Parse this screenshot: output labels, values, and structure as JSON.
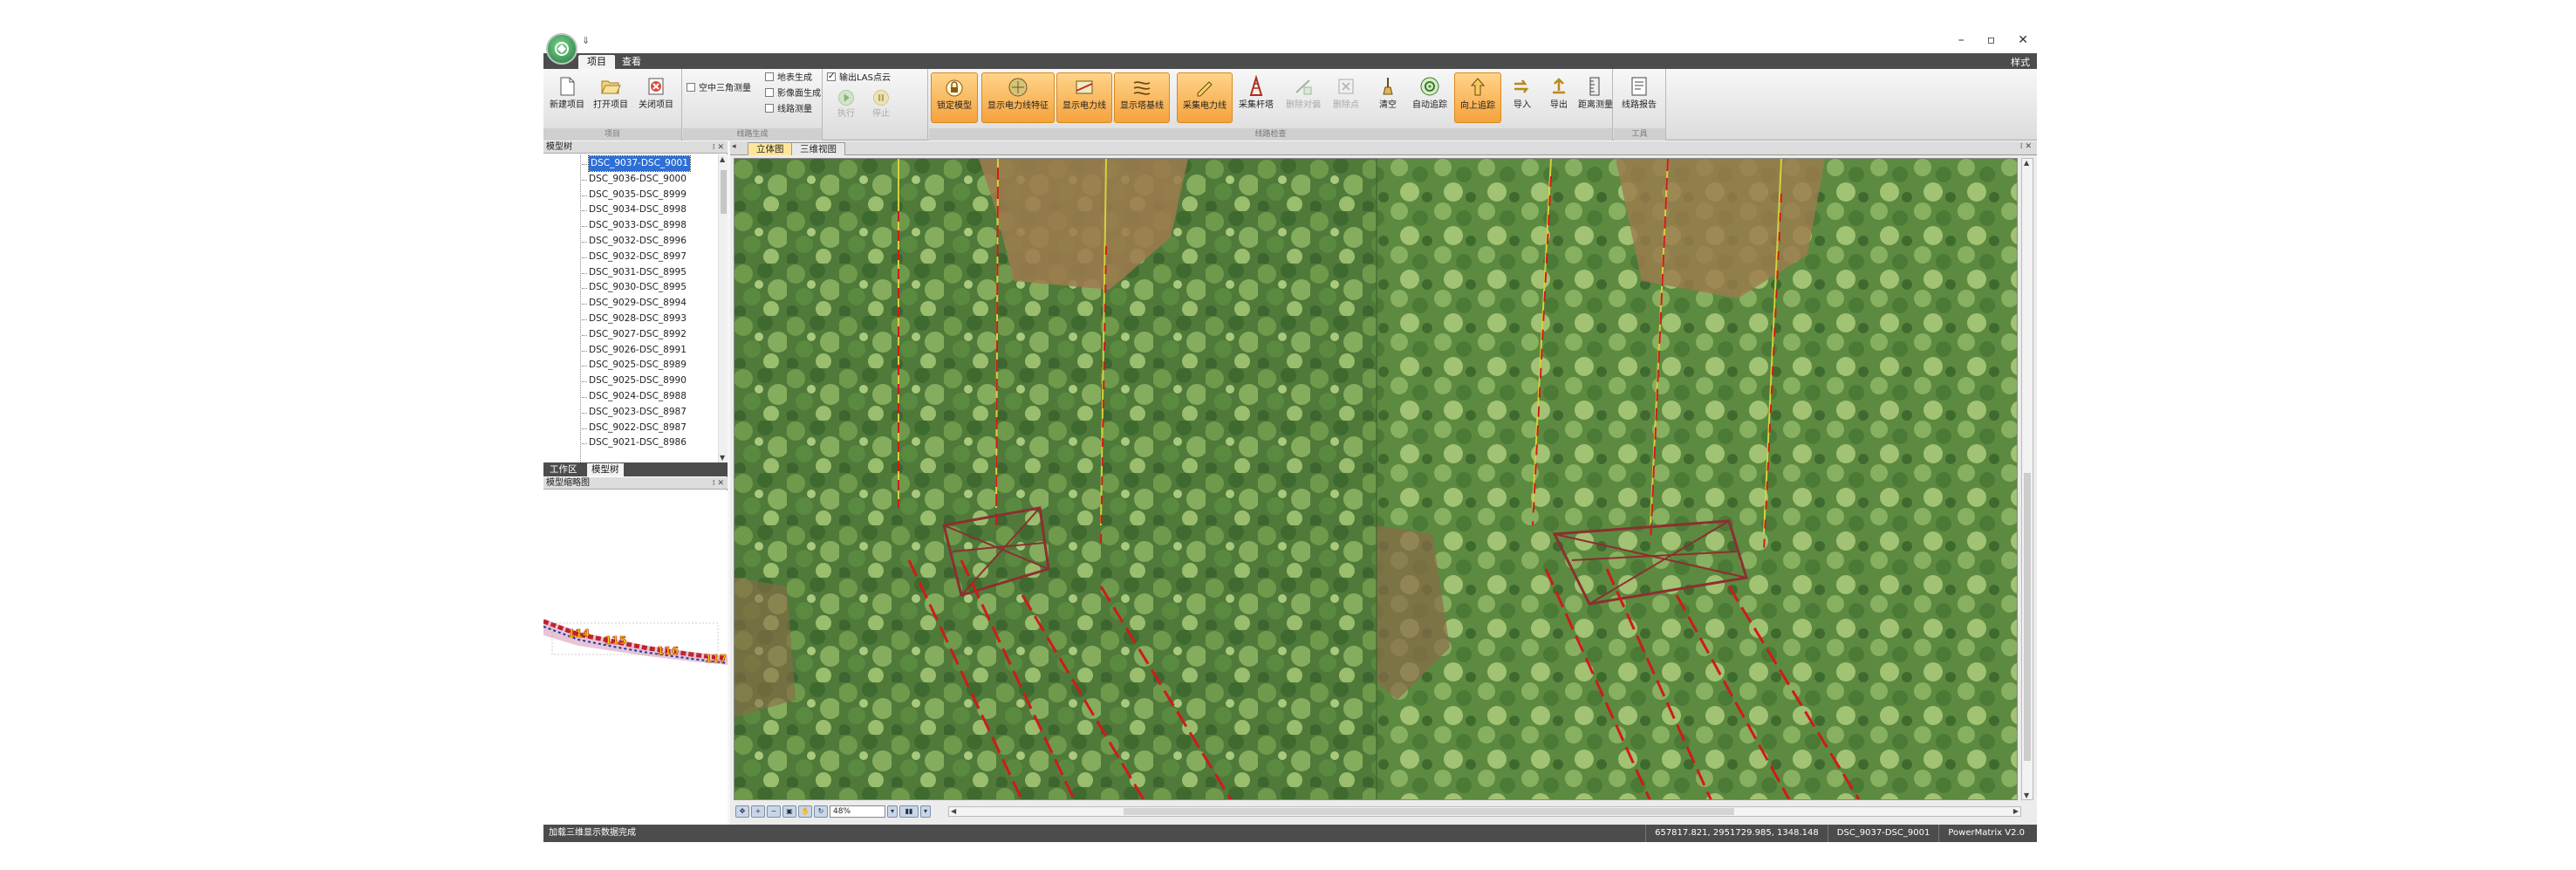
{
  "titlebar": {
    "qat": "⇓",
    "minimize": "–",
    "restore": "▫",
    "close": "✕"
  },
  "tabs": {
    "project": "项目",
    "view": "查看",
    "style": "样式"
  },
  "ribbon": {
    "groups": {
      "project": "项目",
      "line_gen": "线路生成",
      "line_detect": "线路检查",
      "tools": "工具"
    },
    "new_project": "新建项目",
    "open_project": "打开项目",
    "close_project": "关闭项目",
    "aerial_triangulation": "空中三角测量",
    "terrain_gen": "地表生成",
    "image_gen": "影像面生成",
    "line_measure": "线路测量",
    "export_las": "输出LAS点云",
    "execute": "执行",
    "stop": "停止",
    "lock_model": "锁定模型",
    "show_power_feature": "显示电力线特征",
    "show_power_line": "显示电力线",
    "show_tower_line": "显示塔基线",
    "collect_power_line": "采集电力线",
    "collect_tower": "采集杆塔",
    "delete_parallel": "删除对偏",
    "delete_point": "删除点",
    "clear": "清空",
    "auto_track": "自动追踪",
    "up_track": "向上追踪",
    "import": "导入",
    "export": "导出",
    "distance_measure": "距离测量",
    "line_report": "线路报告"
  },
  "left_panel": {
    "tree_title": "模型树",
    "items": [
      "DSC_9037-DSC_9001",
      "DSC_9036-DSC_9000",
      "DSC_9035-DSC_8999",
      "DSC_9034-DSC_8998",
      "DSC_9033-DSC_8998",
      "DSC_9032-DSC_8996",
      "DSC_9032-DSC_8997",
      "DSC_9031-DSC_8995",
      "DSC_9030-DSC_8995",
      "DSC_9029-DSC_8994",
      "DSC_9028-DSC_8993",
      "DSC_9027-DSC_8992",
      "DSC_9026-DSC_8991",
      "DSC_9025-DSC_8989",
      "DSC_9025-DSC_8990",
      "DSC_9024-DSC_8988",
      "DSC_9023-DSC_8987",
      "DSC_9022-DSC_8987",
      "DSC_9021-DSC_8986"
    ],
    "tabs": [
      "工作区",
      "模型树"
    ],
    "overview_title": "模型缩略图",
    "overview_labels": [
      "114",
      "115",
      "116",
      "117"
    ]
  },
  "image_area": {
    "tabs": [
      "立体图",
      "三维视图"
    ],
    "zoom": "48%"
  },
  "status": {
    "left": "加载三维显示数据完成",
    "coords": "657817.821, 2951729.985, 1348.148",
    "model": "DSC_9037-DSC_9001",
    "version": "PowerMatrix V2.0"
  }
}
